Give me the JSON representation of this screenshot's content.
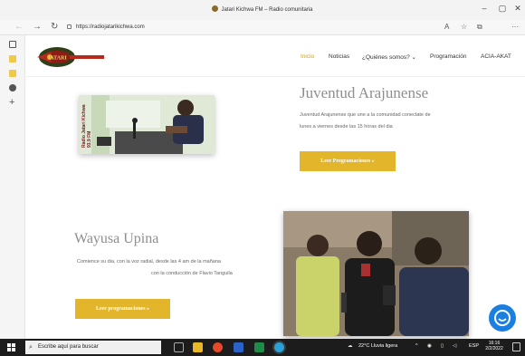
{
  "browser": {
    "tab_title": "Jatari Kichwa FM – Radio comunitaria",
    "url": "https://radiojatarikichwa.com",
    "back_icon": "arrow-left",
    "forward_icon": "arrow-right",
    "reload_icon": "refresh"
  },
  "site": {
    "menu": [
      "Inicio",
      "Noticias",
      "¿Quiénes somos? ⌄",
      "Programación",
      "ACIA-AKAT"
    ],
    "active_menu": "Inicio",
    "logo_text": "JATARI"
  },
  "section1": {
    "title": "Juventud Arajunense",
    "text_line1": "Juventud Arajunense que une a la comunidad conectate de",
    "text_line2": "lunes a viernes desde las 15 horas del dia",
    "button": "Leer Programaciones »",
    "photo_caption": "Radio Jatari Kichwa 93.9 FM"
  },
  "section2": {
    "title": "Wayusa Upina",
    "text_line1": "Comience su dia, con la voz radial, desde las 4 am de la mañana",
    "text_line2": "con la conducción de Flavio Tanguila",
    "button": "Leer programaciones »"
  },
  "taskbar": {
    "search_placeholder": "Escribe aquí para buscar",
    "weather": "22°C  Lluvia ligera",
    "language": "ESP",
    "time": "16:16",
    "date": "2/2/2022"
  },
  "colors": {
    "accent": "#e2b52a",
    "heading": "#8e8e8e",
    "taskbar": "#1c1c1c",
    "chat": "#1a7fe0"
  }
}
